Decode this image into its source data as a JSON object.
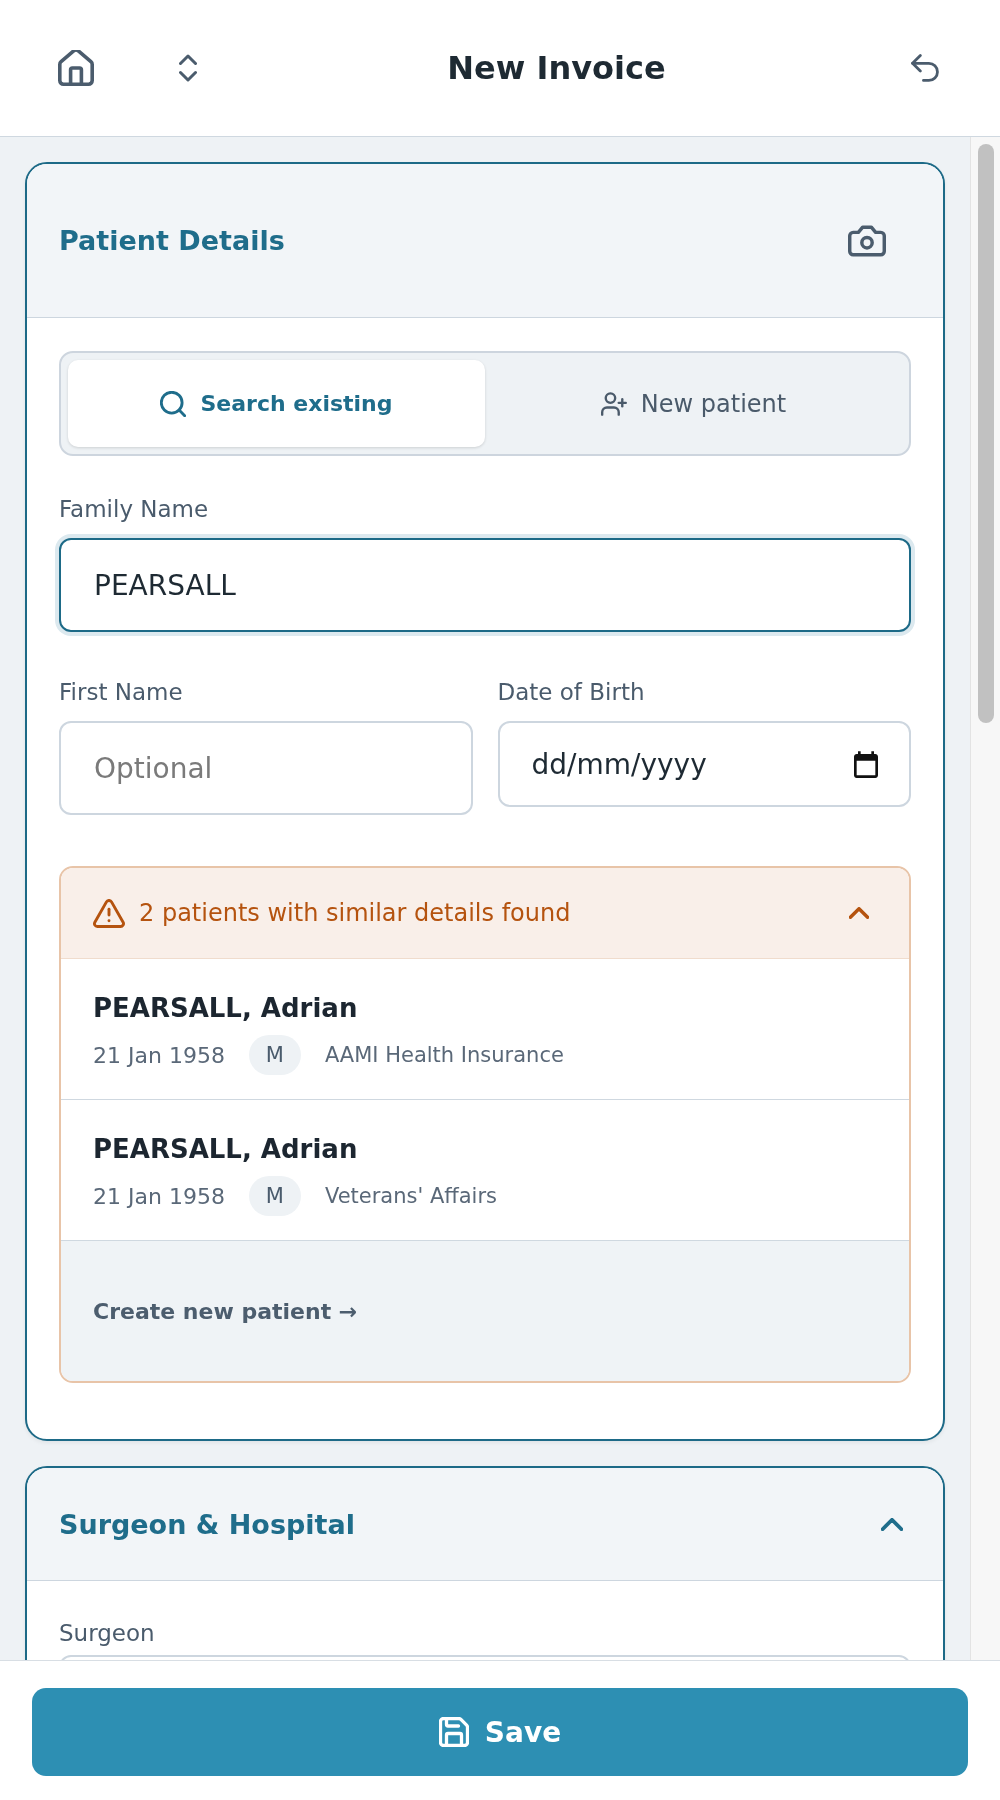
{
  "header": {
    "title": "New Invoice"
  },
  "patient_details": {
    "title": "Patient Details",
    "mode_tabs": [
      {
        "label": "Search existing",
        "kind": "search",
        "selected": true
      },
      {
        "label": "New patient",
        "kind": "create",
        "selected": false
      }
    ],
    "field_rows": [
      {
        "fields": [
          {
            "label": "Family Name",
            "kind": "text",
            "value": "PEARSALL",
            "focused": true
          }
        ]
      },
      {
        "fields": [
          {
            "label": "First Name",
            "kind": "text",
            "placeholder": "Optional",
            "focused": false
          },
          {
            "label": "Date of Birth",
            "kind": "date",
            "placeholder": "dd/mm/yyyy",
            "focused": false
          }
        ]
      }
    ],
    "matches": {
      "message": "2 patients with similar details found",
      "expanded": true,
      "patients": [
        {
          "name": "PEARSALL, Adrian",
          "dob": "21 Jan 1958",
          "sex": "M",
          "insurer": "AAMI Health Insurance"
        },
        {
          "name": "PEARSALL, Adrian",
          "dob": "21 Jan 1958",
          "sex": "M",
          "insurer": "Veterans' Affairs"
        }
      ],
      "create_link": "Create new patient →"
    }
  },
  "surgeon_hospital": {
    "title": "Surgeon & Hospital",
    "expanded": true,
    "fields": [
      {
        "label": "Surgeon",
        "kind": "text",
        "focused": false
      }
    ]
  },
  "footer": {
    "save_button": "Save"
  }
}
